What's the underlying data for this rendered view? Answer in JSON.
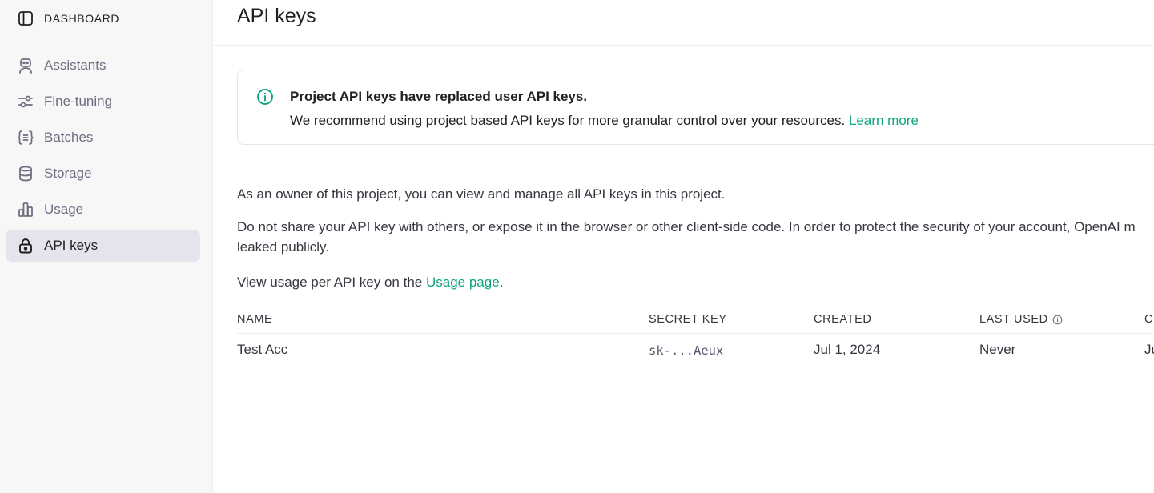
{
  "sidebar": {
    "header": {
      "label": "DASHBOARD",
      "icon": "sidebar-panel-icon"
    },
    "items": [
      {
        "label": "Assistants",
        "icon": "robot-icon",
        "active": false
      },
      {
        "label": "Fine-tuning",
        "icon": "sliders-icon",
        "active": false
      },
      {
        "label": "Batches",
        "icon": "braces-list-icon",
        "active": false
      },
      {
        "label": "Storage",
        "icon": "database-icon",
        "active": false
      },
      {
        "label": "Usage",
        "icon": "bar-chart-icon",
        "active": false
      },
      {
        "label": "API keys",
        "icon": "lock-icon",
        "active": true
      }
    ]
  },
  "header": {
    "title": "API keys"
  },
  "notice": {
    "icon": "info-icon",
    "title": "Project API keys have replaced user API keys.",
    "body": "We recommend using project based API keys for more granular control over your resources.",
    "link": "Learn more"
  },
  "intro": {
    "p1": "As an owner of this project, you can view and manage all API keys in this project.",
    "p2": "Do not share your API key with others, or expose it in the browser or other client-side code. In order to protect the security of your account, OpenAI m",
    "p2b": "leaked publicly.",
    "p3_before": "View usage per API key on the",
    "p3_link": "Usage page",
    "p3_after": "."
  },
  "table": {
    "columns": [
      "NAME",
      "SECRET KEY",
      "CREATED",
      "LAST USED",
      "C"
    ],
    "rows": [
      {
        "name": "Test Acc",
        "secret_key": "sk-...Aeux",
        "created": "Jul 1, 2024",
        "last_used": "Never",
        "extra": "Ju"
      }
    ]
  },
  "colors": {
    "accent": "#10a37f",
    "sidebar_bg": "#f7f7f8",
    "active_bg": "#e4e4ec"
  }
}
